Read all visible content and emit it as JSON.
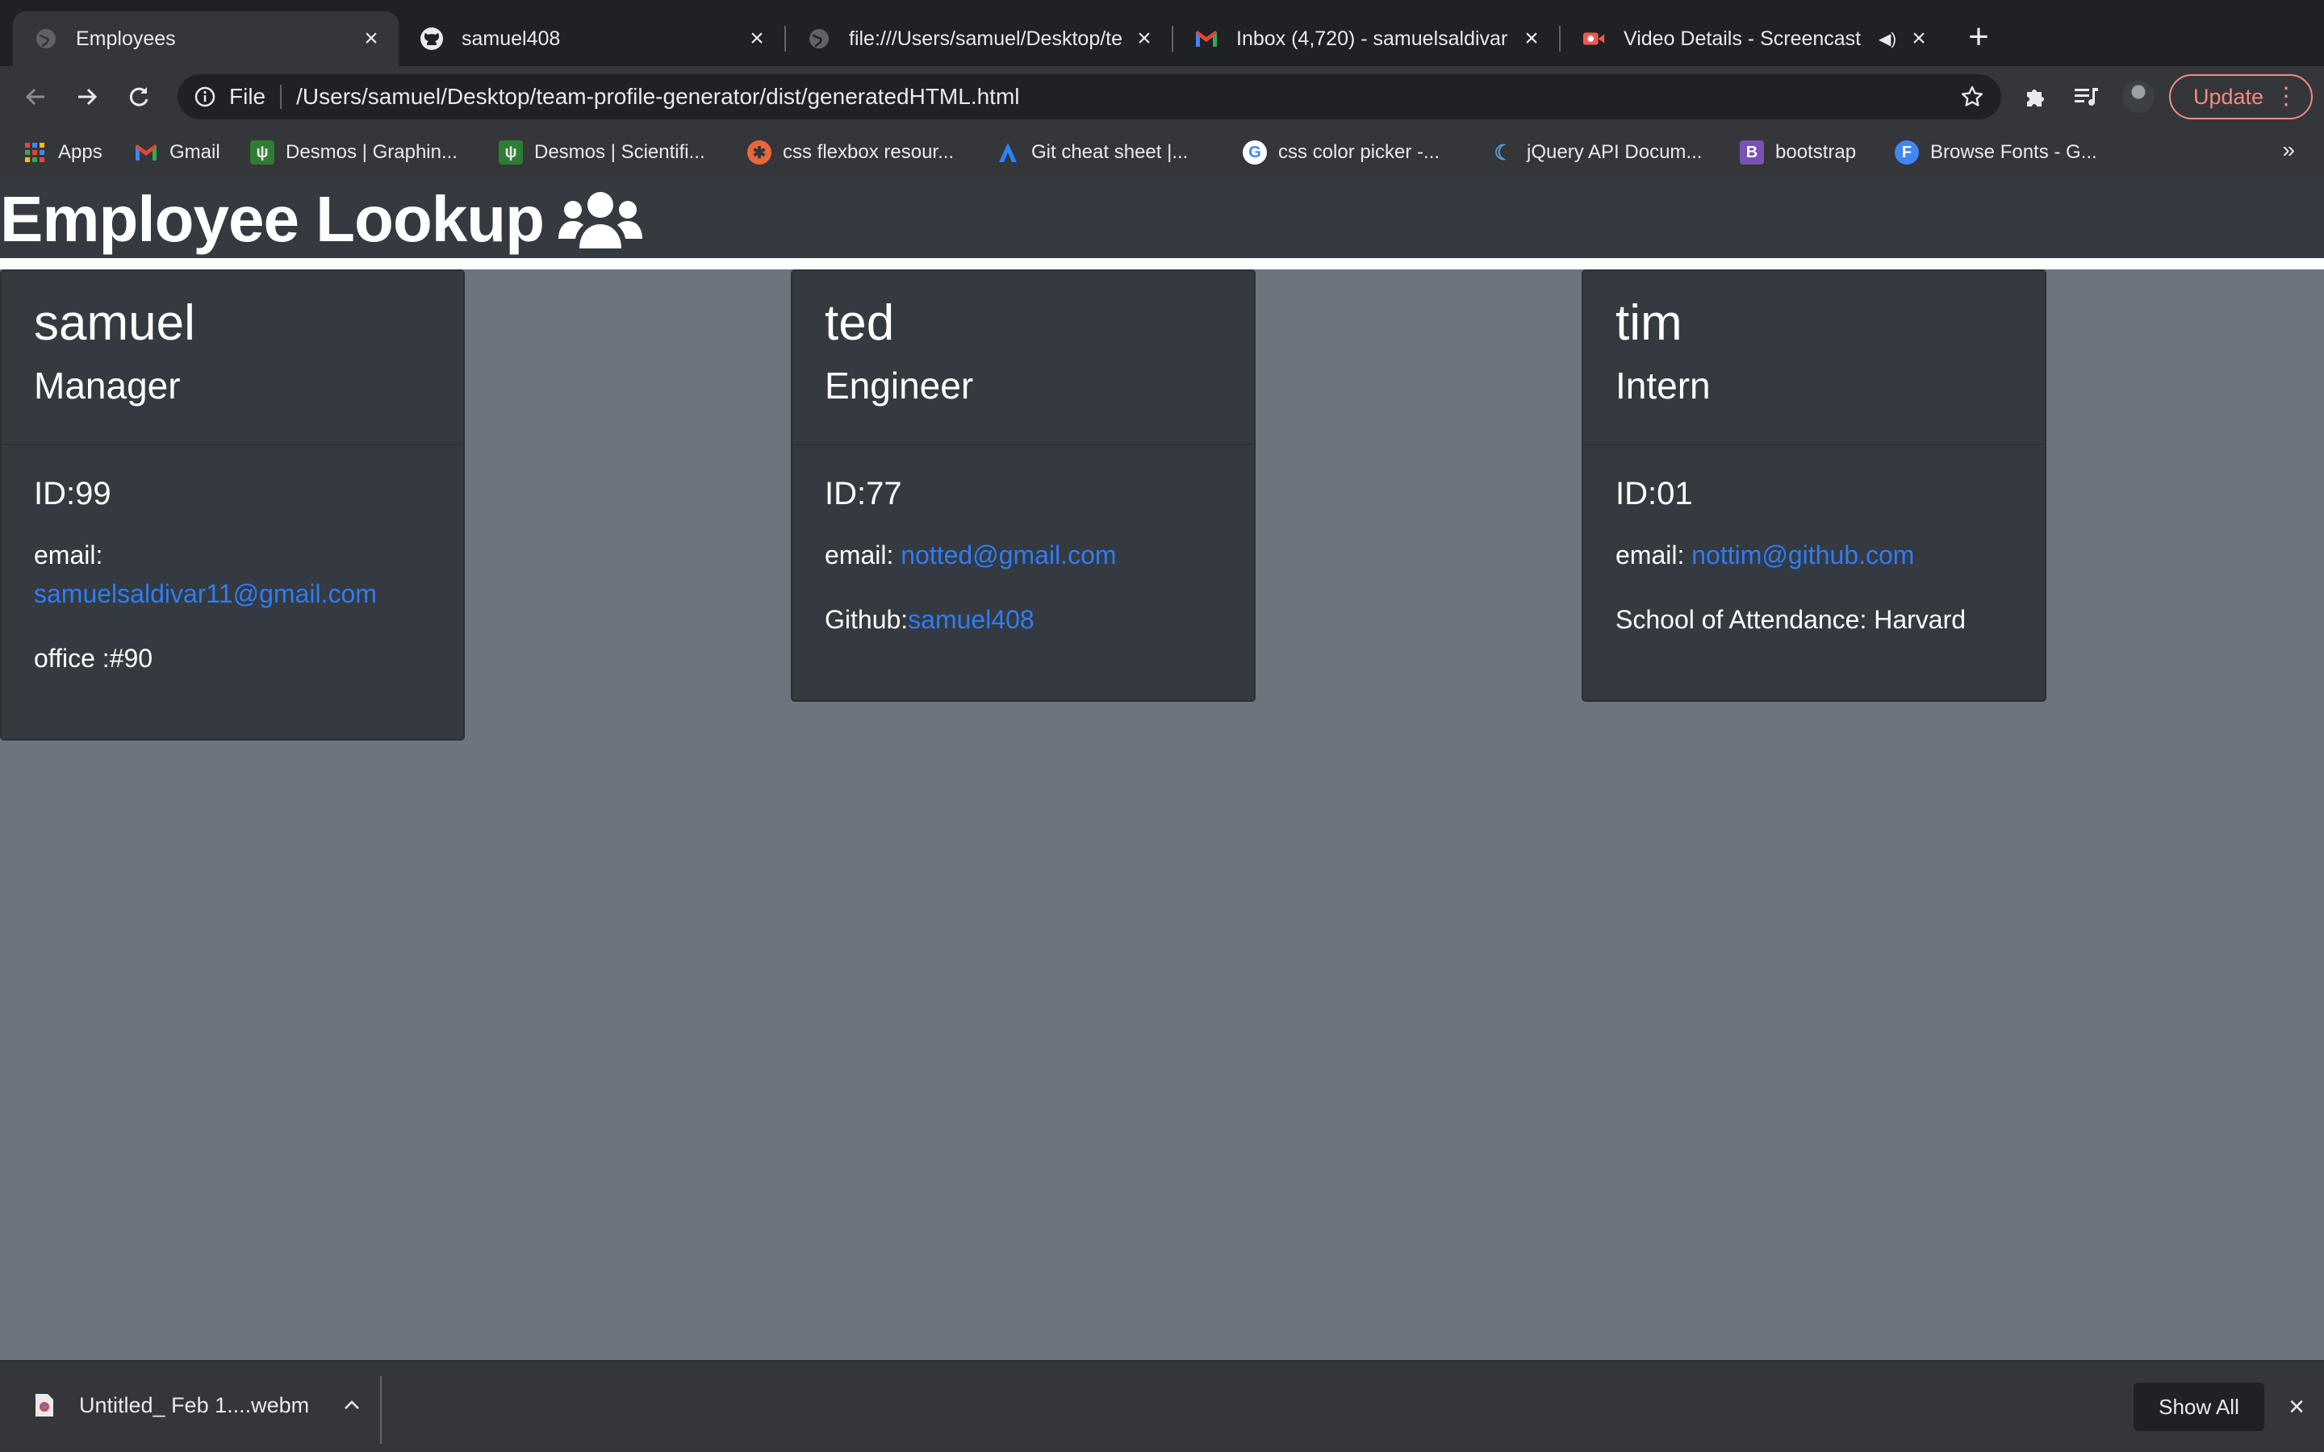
{
  "browser": {
    "tabs": [
      {
        "title": "Employees",
        "icon": "globe-icon",
        "active": true
      },
      {
        "title": "samuel408",
        "icon": "github-icon",
        "active": false
      },
      {
        "title": "file:///Users/samuel/Desktop/te",
        "icon": "globe-icon",
        "active": false
      },
      {
        "title": "Inbox (4,720) - samuelsaldivar",
        "icon": "gmail-icon",
        "active": false
      },
      {
        "title": "Video Details - Screencast",
        "icon": "screencastify-icon",
        "active": false
      }
    ],
    "new_tab_label": "+",
    "address": {
      "scheme": "File",
      "url": "/Users/samuel/Desktop/team-profile-generator/dist/generatedHTML.html"
    },
    "update_button": "Update",
    "bookmarks": [
      {
        "label": "Apps",
        "icon": "apps-grid-icon"
      },
      {
        "label": "Gmail",
        "icon": "gmail-icon"
      },
      {
        "label": "Desmos | Graphin...",
        "icon": "desmos-icon"
      },
      {
        "label": "Desmos | Scientifi...",
        "icon": "desmos-icon"
      },
      {
        "label": "css flexbox resour...",
        "icon": "flexbox-icon"
      },
      {
        "label": "Git cheat sheet |...",
        "icon": "atlassian-icon"
      },
      {
        "label": "css color picker -...",
        "icon": "google-icon"
      },
      {
        "label": "jQuery API Docum...",
        "icon": "jquery-icon"
      },
      {
        "label": "bootstrap",
        "icon": "bootstrap-icon"
      },
      {
        "label": "Browse Fonts - G...",
        "icon": "google-fonts-icon"
      }
    ],
    "bookmarks_overflow": "»",
    "colors": {
      "frame": "#202124",
      "toolbar": "#35363a",
      "update_accent": "#f28b82"
    }
  },
  "page": {
    "title": "Employee Lookup",
    "title_icon": "users-icon",
    "employees": [
      {
        "name": "samuel",
        "role": "Manager",
        "id": "ID:99",
        "email_label": "email:",
        "email": "samuelsaldivar11@gmail.com",
        "extra_label": "office :#90"
      },
      {
        "name": "ted",
        "role": "Engineer",
        "id": "ID:77",
        "email_label": "email:",
        "email": "notted@gmail.com",
        "extra_label": "Github:",
        "extra_link": "samuel408"
      },
      {
        "name": "tim",
        "role": "Intern",
        "id": "ID:01",
        "email_label": "email:",
        "email": "nottim@github.com",
        "extra_label": "School of Attendance: Harvard"
      }
    ],
    "colors": {
      "background": "#6c757d",
      "card": "#343a40",
      "link": "#2f7cf6",
      "text": "#ffffff"
    }
  },
  "downloads": {
    "file_name": "Untitled_ Feb 1....webm",
    "show_all": "Show All"
  }
}
